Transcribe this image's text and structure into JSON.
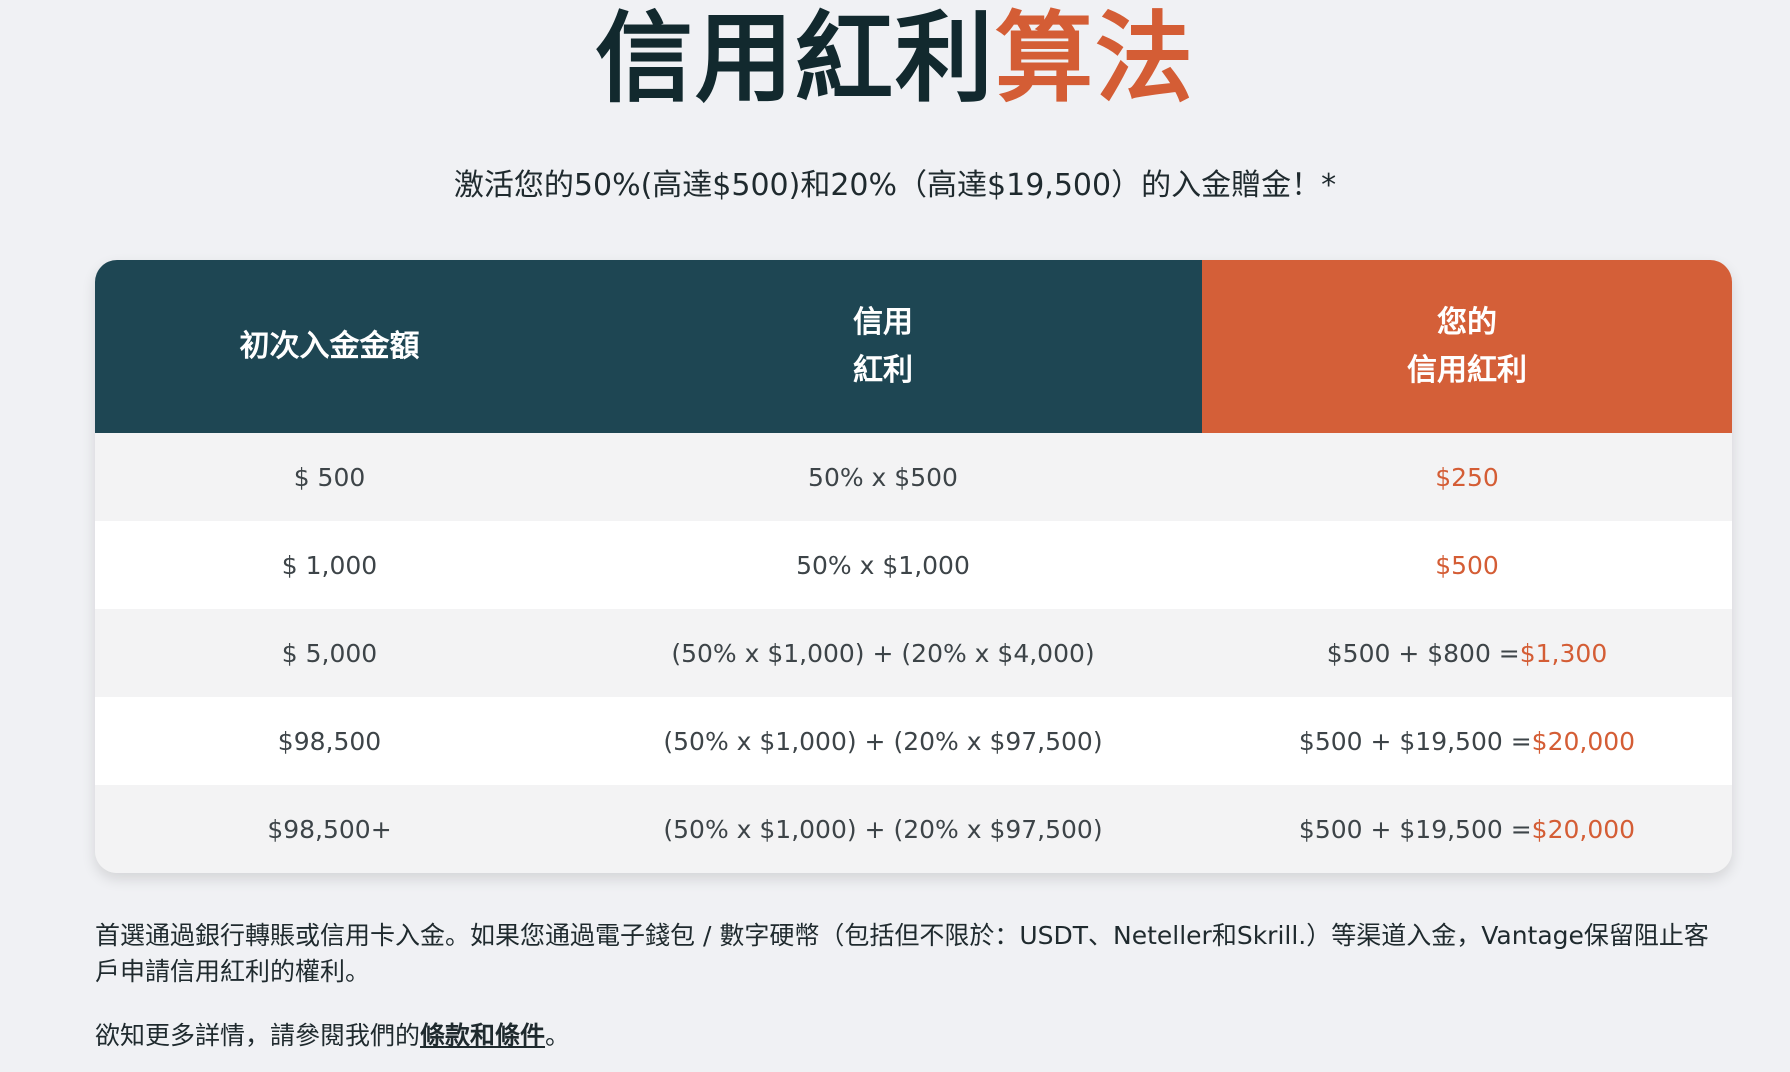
{
  "title": {
    "main": "信用紅利",
    "accent": "算法"
  },
  "subtitle": "激活您的50%(高達$500)和20%（高達$19,500）的入金贈金！*",
  "table": {
    "headers": [
      "初次入金金額",
      "信用\n紅利",
      "您的\n信用紅利"
    ],
    "rows": [
      {
        "deposit": "$ 500",
        "formula": "50% x $500",
        "result_prefix": "",
        "result_value": "$250"
      },
      {
        "deposit": "$ 1,000",
        "formula": "50% x $1,000",
        "result_prefix": "",
        "result_value": "$500"
      },
      {
        "deposit": "$ 5,000",
        "formula": "(50% x $1,000) + (20% x $4,000)",
        "result_prefix": "$500 + $800 = ",
        "result_value": "$1,300"
      },
      {
        "deposit": "$98,500",
        "formula": "(50% x $1,000) + (20% x $97,500)",
        "result_prefix": "$500 + $19,500 = ",
        "result_value": "$20,000"
      },
      {
        "deposit": "$98,500+",
        "formula": "(50% x $1,000) + (20% x $97,500)",
        "result_prefix": "$500 + $19,500 = ",
        "result_value": "$20,000"
      }
    ]
  },
  "note": "首選通過銀行轉賬或信用卡入金。如果您通過電子錢包 / 數字硬幣（包括但不限於：USDT、Neteller和Skrill.）等渠道入金，Vantage保留阻止客戶申請信用紅利的權利。",
  "more": {
    "prefix": "欲知更多詳情，請參閱我們的",
    "link": "條款和條件",
    "suffix": "。"
  },
  "colors": {
    "accent": "#d45d35",
    "header_dark": "#1e4653",
    "header_accent": "#d45f38"
  }
}
